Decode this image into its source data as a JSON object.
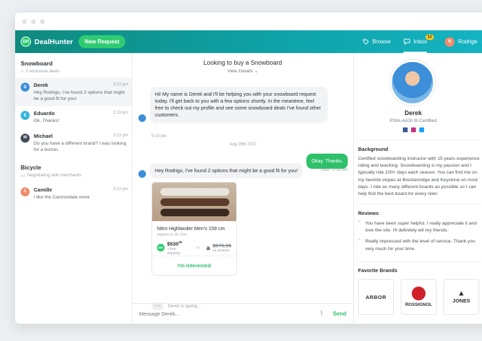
{
  "app": {
    "logo_badge": "DH",
    "name": "DealHunter",
    "new_request": "New Request"
  },
  "nav": {
    "browse": "Browse",
    "inbox": "Inbox",
    "inbox_count": "12",
    "user_initial": "R",
    "user_name": "Rodrige"
  },
  "sidebar": {
    "groups": [
      {
        "title": "Snowboard",
        "subtitle": "2 exclusive deals",
        "items": [
          {
            "initial": "D",
            "name": "Derek",
            "time": "3:13 pm",
            "text": "Hey Rodrigo, I've found 2 options that might be a good fit for you!",
            "color": "#3c8fd8"
          },
          {
            "initial": "E",
            "name": "Eduardo",
            "time": "3:13 pm",
            "text": "Ok, Thanks!",
            "color": "#33b5d8"
          },
          {
            "initial": "M",
            "name": "Michael",
            "time": "3:13 pm",
            "text": "Do you have a different brand? I was looking for a burton.",
            "color": "#3e4a57"
          }
        ]
      },
      {
        "title": "Bicycle",
        "subtitle": "Negotiating with merchants",
        "items": [
          {
            "initial": "C",
            "name": "Camille",
            "time": "3:13 pm",
            "text": "I like the Cannondale more",
            "color": "#f08a6b"
          }
        ]
      }
    ]
  },
  "chat": {
    "title": "Looking to buy a Snowboard",
    "view": "View",
    "details": "Details",
    "msg1": "Hi! My name is Derek and I'll be helping you with your snowboard request today. I'll get back to you with a few options shortly. In the meantime, feel free to check out my profile and see some snowboard deals I've found other customers.",
    "msg1_time": "5:15 pm",
    "date_divider": "Aug 29th 2017",
    "msg2": "Okay. Thanks.",
    "msg2_status": "read · 9:18 am",
    "msg3": "Hey Rodrigo, I've found 2 options that might be a good fit for you!",
    "product": {
      "title": "Nitro Highlander Men's 159 cm",
      "expires": "expires in 2h 12m",
      "price": "$530",
      "price_cents": "36",
      "shipping": "+ free shipping",
      "vs": "vs",
      "amazon_logo": "a",
      "amazon_price": "$679,96",
      "amazon_sub": "on amazon",
      "cta": "I'm Interested"
    },
    "typing": "Derek is typing...",
    "composer_placeholder": "Message Derek...",
    "send": "Send"
  },
  "profile": {
    "name": "Derek",
    "role": "PSIA-AASI III Certified",
    "background_title": "Background",
    "background_text": "Certified snowboarding instructor with 15 years experience riding and teaching. Snowboarding is my passion and I typically ride 100+ days each season. You can find me on my favorite slopes at Breckenridge and Keystone on most days. I ride as many different boards as possible so I can help find the best board for every rider.",
    "reviews_title": "Reviews",
    "reviews": [
      "You have been super helpful. I really appreciate it and love the site. I'll definitely tell my friends.",
      "Really impressed with the level of service. Thank you very much for your time."
    ],
    "brands_title": "Favorite Brands",
    "brands": [
      "ARBOR",
      "ROSSIGNOL",
      "JONES"
    ]
  },
  "colors": {
    "accent_green": "#2fc06a",
    "header_teal": "#0fa2a8"
  }
}
